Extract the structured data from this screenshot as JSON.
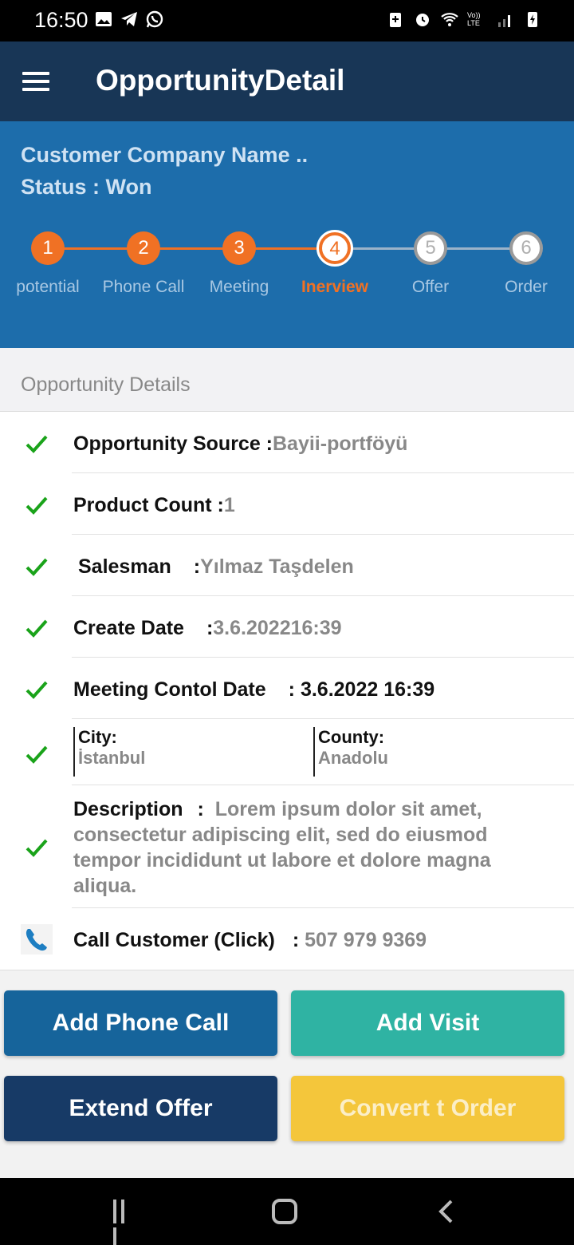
{
  "status_bar": {
    "time": "16:50",
    "network_label": "Vo)) LTE"
  },
  "app_bar": {
    "title": "OpportunityDetail",
    "menu_icon": "hamburger-menu-icon"
  },
  "header": {
    "company": "Customer Company Name ..",
    "status": "Status : Won"
  },
  "stepper": {
    "steps": [
      {
        "number": "1",
        "label": "potential",
        "state": "done"
      },
      {
        "number": "2",
        "label": "Phone Call",
        "state": "done"
      },
      {
        "number": "3",
        "label": "Meeting",
        "state": "done"
      },
      {
        "number": "4",
        "label": "Inerview",
        "state": "current"
      },
      {
        "number": "5",
        "label": "Offer",
        "state": "todo"
      },
      {
        "number": "6",
        "label": "Order",
        "state": "todo"
      }
    ]
  },
  "section": {
    "title": "Opportunity Details"
  },
  "details": {
    "source": {
      "label": "Opportunity Source :",
      "value": "Bayii-portföyü"
    },
    "product_count": {
      "label": "Product Count :",
      "value": "1"
    },
    "salesman": {
      "label": "Salesman",
      "sep": ":",
      "value": "Yılmaz Taşdelen"
    },
    "create_date": {
      "label": "Create Date",
      "sep": ":",
      "value": "3.6.202216:39"
    },
    "meeting_date": {
      "label": "Meeting Contol Date",
      "sep": ":",
      "value": "3.6.2022 16:39"
    },
    "city": {
      "label": "City:",
      "value": "İstanbul"
    },
    "county": {
      "label": "County:",
      "value": "Anadolu"
    },
    "description": {
      "label": "Description",
      "sep": ":",
      "value": "Lorem ipsum dolor sit amet, consectetur adipiscing elit, sed do eiusmod tempor incididunt ut labore et dolore magna aliqua."
    },
    "call": {
      "label": "Call Customer (Click)",
      "sep": ":",
      "value": "507 979 9369"
    }
  },
  "buttons": {
    "add_phone_call": "Add Phone Call",
    "add_visit": "Add Visit",
    "extend_offer": "Extend Offer",
    "convert_order": "Convert t Order"
  },
  "colors": {
    "appbar": "#183656",
    "header": "#1d6dab",
    "accent_orange": "#f07124",
    "check_green": "#1aa31a"
  }
}
